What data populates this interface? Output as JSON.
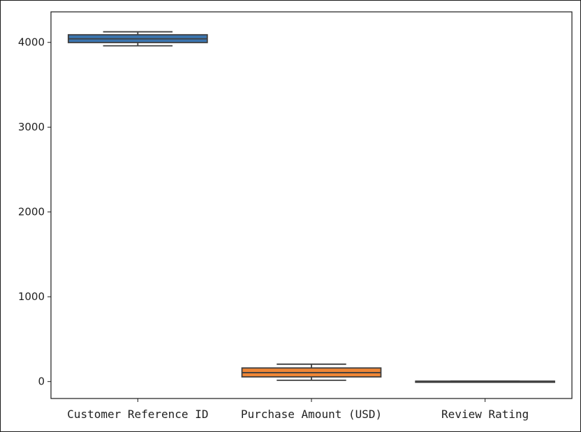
{
  "chart_data": {
    "type": "boxplot",
    "title": "",
    "xlabel": "",
    "ylabel": "",
    "ylim": [
      -200,
      4360
    ],
    "yticks": [
      0,
      1000,
      2000,
      3000,
      4000
    ],
    "ytick_labels": [
      "0",
      "1000",
      "2000",
      "3000",
      "4000"
    ],
    "grid": false,
    "categories": [
      "Customer Reference ID",
      "Purchase Amount (USD)",
      "Review Rating"
    ],
    "boxes": [
      {
        "category": "Customer Reference ID",
        "whislo": 3960,
        "q1": 3998,
        "med": 4042,
        "q3": 4090,
        "whishi": 4125,
        "color": "#3b75af"
      },
      {
        "category": "Purchase Amount (USD)",
        "whislo": 15,
        "q1": 55,
        "med": 105,
        "q3": 160,
        "whishi": 205,
        "color": "#ef8636"
      },
      {
        "category": "Review Rating",
        "whislo": 1,
        "q1": 2,
        "med": 3,
        "q3": 4,
        "whishi": 5,
        "color": "#3a923a"
      }
    ]
  }
}
